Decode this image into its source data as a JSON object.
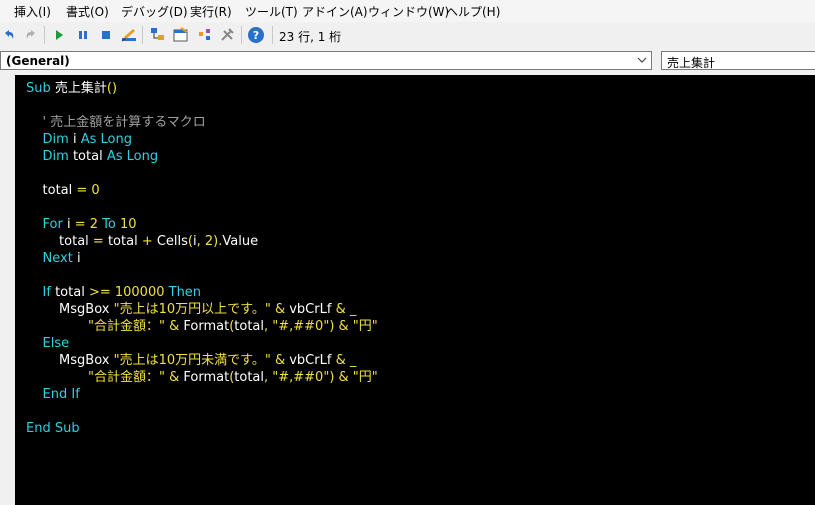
{
  "menu": [
    "挿入(I)",
    "書式(O)",
    "デバッグ(D)",
    "実行(R)",
    "ツール(T)",
    "アドイン(A)",
    "ウィンドウ(W)",
    "ヘルプ(H)"
  ],
  "toolbar": {
    "cursor_position": "23 行, 1 桁",
    "icons": [
      "undo-icon",
      "redo-icon",
      "run-icon",
      "pause-icon",
      "stop-icon",
      "design-mode-icon",
      "project-explorer-icon",
      "properties-icon",
      "object-browser-icon",
      "toolbox-icon",
      "help-icon"
    ]
  },
  "object_combo": "(General)",
  "procedure_combo": "売上集計",
  "code_lines": [
    [
      [
        "kw",
        "Sub "
      ],
      [
        "id",
        "売上集計"
      ],
      [
        "op",
        "()"
      ]
    ],
    [],
    [
      [
        "id",
        "    "
      ],
      [
        "cmt",
        "' 売上金額を計算するマクロ"
      ]
    ],
    [
      [
        "id",
        "    "
      ],
      [
        "kw",
        "Dim "
      ],
      [
        "id",
        "i "
      ],
      [
        "kw",
        "As Long"
      ]
    ],
    [
      [
        "id",
        "    "
      ],
      [
        "kw",
        "Dim "
      ],
      [
        "id",
        "total "
      ],
      [
        "kw",
        "As Long"
      ]
    ],
    [],
    [
      [
        "id",
        "    total "
      ],
      [
        "op",
        "= "
      ],
      [
        "num",
        "0"
      ]
    ],
    [],
    [
      [
        "id",
        "    "
      ],
      [
        "kw",
        "For "
      ],
      [
        "id",
        "i "
      ],
      [
        "op",
        "= "
      ],
      [
        "num",
        "2 "
      ],
      [
        "kw",
        "To "
      ],
      [
        "num",
        "10"
      ]
    ],
    [
      [
        "id",
        "        total "
      ],
      [
        "op",
        "= "
      ],
      [
        "id",
        "total "
      ],
      [
        "op",
        "+ "
      ],
      [
        "id",
        "Cells"
      ],
      [
        "op",
        "("
      ],
      [
        "id",
        "i"
      ],
      [
        "op",
        ", "
      ],
      [
        "num",
        "2"
      ],
      [
        "op",
        ")."
      ],
      [
        "id",
        "Value"
      ]
    ],
    [
      [
        "id",
        "    "
      ],
      [
        "kw",
        "Next "
      ],
      [
        "id",
        "i"
      ]
    ],
    [],
    [
      [
        "id",
        "    "
      ],
      [
        "kw",
        "If "
      ],
      [
        "id",
        "total "
      ],
      [
        "op",
        ">= "
      ],
      [
        "num",
        "100000 "
      ],
      [
        "kw",
        "Then"
      ]
    ],
    [
      [
        "id",
        "        MsgBox "
      ],
      [
        "str",
        "\"売上は10万円以上です。\" "
      ],
      [
        "op",
        "& "
      ],
      [
        "id",
        "vbCrLf "
      ],
      [
        "op",
        "& _"
      ]
    ],
    [
      [
        "id",
        "               "
      ],
      [
        "str",
        "\"合計金額：\" "
      ],
      [
        "op",
        "& "
      ],
      [
        "id",
        "Format"
      ],
      [
        "op",
        "("
      ],
      [
        "id",
        "total"
      ],
      [
        "op",
        ", "
      ],
      [
        "str",
        "\"#,##0\""
      ],
      [
        "op",
        ") & "
      ],
      [
        "str",
        "\"円\""
      ]
    ],
    [
      [
        "id",
        "    "
      ],
      [
        "kw",
        "Else"
      ]
    ],
    [
      [
        "id",
        "        MsgBox "
      ],
      [
        "str",
        "\"売上は10万円未満です。\" "
      ],
      [
        "op",
        "& "
      ],
      [
        "id",
        "vbCrLf "
      ],
      [
        "op",
        "& _"
      ]
    ],
    [
      [
        "id",
        "               "
      ],
      [
        "str",
        "\"合計金額：\" "
      ],
      [
        "op",
        "& "
      ],
      [
        "id",
        "Format"
      ],
      [
        "op",
        "("
      ],
      [
        "id",
        "total"
      ],
      [
        "op",
        ", "
      ],
      [
        "str",
        "\"#,##0\""
      ],
      [
        "op",
        ") & "
      ],
      [
        "str",
        "\"円\""
      ]
    ],
    [
      [
        "id",
        "    "
      ],
      [
        "kw",
        "End If"
      ]
    ],
    [],
    [
      [
        "kw",
        "End Sub"
      ]
    ]
  ]
}
